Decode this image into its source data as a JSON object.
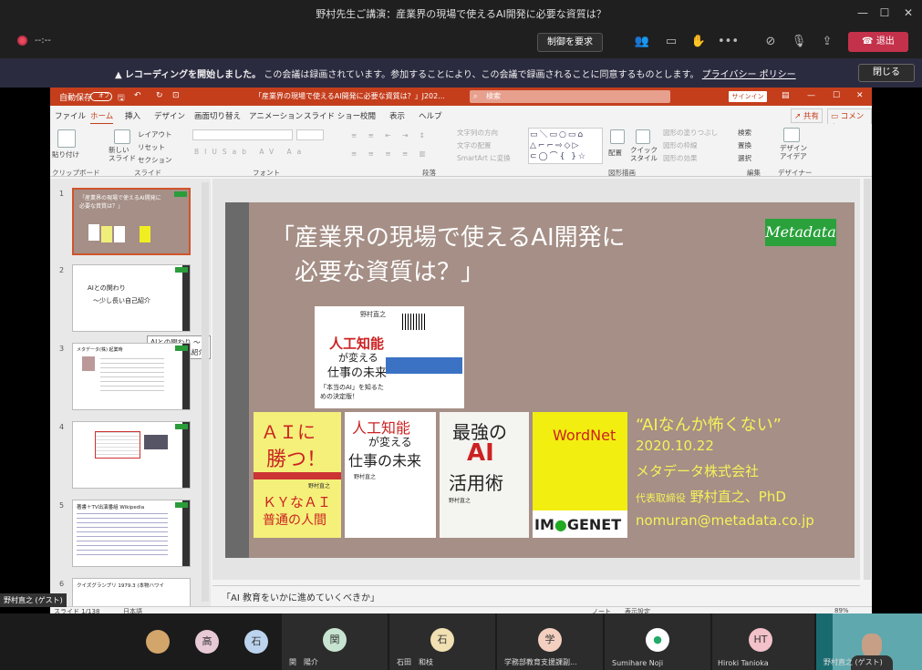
{
  "teams": {
    "title": "野村先生ご講演：産業界の現場で使えるAI開発に必要な資質は？",
    "timer": "--:--",
    "request_control": "制御を要求",
    "leave": "退出"
  },
  "banner": {
    "prefix": "レコーディングを開始しました。",
    "message": "この会議は録画されています。参加することにより、この会議で録画されることに同意するものとします。",
    "link": "プライバシー ポリシー",
    "close": "閉じる"
  },
  "ppt": {
    "autosave": "自動保存",
    "autosave_state": "オフ",
    "doc_title": "「産業界の現場で使えるAI開発に必要な資質は？」J202...",
    "search": "検索",
    "signin": "サインイン",
    "menu": [
      "ファイル",
      "ホーム",
      "挿入",
      "デザイン",
      "画面切り替え",
      "アニメーション",
      "スライド ショー",
      "校閲",
      "表示",
      "ヘルプ"
    ],
    "share": "共有",
    "comment": "コメント",
    "ribbon": {
      "paste": "貼り付け",
      "clipboard": "クリップボード",
      "new_slide": "新しい\nスライド",
      "layout": "レイアウト",
      "reset": "リセット",
      "section": "セクション",
      "slides": "スライド",
      "font": "フォント",
      "paragraph": "段落",
      "text_dir": "文字列の方向",
      "align_text": "文字の配置",
      "smartart": "SmartArt に変換",
      "arrange": "配置",
      "quick_style": "クイック\nスタイル",
      "fill": "図形の塗りつぶし",
      "outline": "図形の枠線",
      "effect": "図形の効果",
      "drawing": "図形描画",
      "find": "検索",
      "replace": "置換",
      "select": "選択",
      "editing": "編集",
      "designer": "デザイン\nアイデア",
      "designer_group": "デザイナー"
    },
    "thumbs": {
      "t1": "「産業界の現場で使えるAI開発に必要な資質は？」",
      "t2_a": "AIとの関わり",
      "t2_b": "〜少し長い自己紹介",
      "t3": "メタデータ(株) 起業時",
      "t5": "著書＋TV出演番組 Wikipedia",
      "t6": "クイズグランプリ 1979.3 (本物ハワイ"
    },
    "tooltip": "AIとの関わり 〜少し長い自己紹介",
    "slide": {
      "title": "「産業界の現場で使えるAI開発に\n　必要な資質は？」",
      "logo": "Metadata",
      "quote": "“AIなんか怖くない”",
      "date": "2020.10.22",
      "company": "メタデータ株式会社",
      "role": "代表取締役",
      "name": "野村直之、PhD",
      "email": "nomuran@metadata.co.jp",
      "b0_author": "野村直之",
      "b0_a": "人工知能",
      "b0_b": "が変える",
      "b0_c": "仕事の未来",
      "b0_band": "「本当のAI」を知るための決定版！",
      "b1_a": "ＡＩに",
      "b1_b": "勝つ！",
      "b1_c": "ＫＹなＡＩ",
      "b1_d": "普通の人間",
      "b1_author": "野村直之",
      "b2_a": "人工知能",
      "b2_b": "が変える",
      "b2_c": "仕事の未来",
      "b2_author": "野村直之",
      "b3_a": "最強の",
      "b3_b": "AI",
      "b3_c": "活用術",
      "b3_author": "野村直之",
      "b4_a": "WordNet",
      "b4_b": "IM",
      "b4_c": "GENET"
    },
    "notes": "「AI 教育をいかに進めていくべきか」",
    "status": {
      "slide": "スライド 1/138",
      "lang": "日本語",
      "note": "ノート",
      "view": "表示設定",
      "zoom": "89%"
    }
  },
  "participants": [
    {
      "initial": "",
      "name": ""
    },
    {
      "initial": "高",
      "name": ""
    },
    {
      "initial": "石",
      "name": ""
    },
    {
      "initial": "関",
      "name": "関　陽介"
    },
    {
      "initial": "石",
      "name": "石田　和枝"
    },
    {
      "initial": "学",
      "name": "学務部教育支援課副..."
    },
    {
      "initial": "",
      "name": "Sumihare Noji"
    },
    {
      "initial": "HT",
      "name": "Hiroki Tanioka"
    }
  ],
  "self": {
    "name": "野村直之 (ゲスト)",
    "cam_name": "野村直之 (ゲスト)"
  },
  "colors": {
    "accent": "#c43e1c",
    "leave": "#c4314b",
    "slide_bg": "#a58f86",
    "yellow_text": "#f5f25a",
    "logo_green": "#2aa13b"
  }
}
